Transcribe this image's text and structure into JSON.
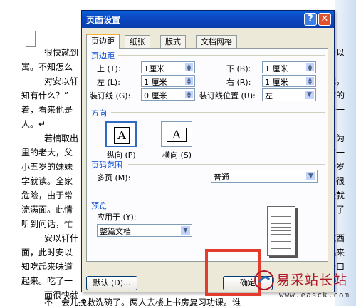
{
  "document": {
    "lines": [
      {
        "left": "很快就到",
        "right": "安以"
      },
      {
        "left": "寓。不知怎么",
        "right": ""
      },
      {
        "left": "对安以轩",
        "right": "吧，"
      },
      {
        "left": "知有什么？”",
        "right": "满的"
      },
      {
        "left": "着，看来他是",
        "right": "是一"
      },
      {
        "left": "人。↵",
        "right": ""
      },
      {
        "left": "若楠取出",
        "right": "因为"
      },
      {
        "left": "里的老大，父",
        "right": "有一"
      },
      {
        "left": "小五岁的妹妹",
        "right": "十岁"
      },
      {
        "left": "学就读。全家",
        "right": "，很"
      },
      {
        "left": "危险，由于常",
        "right": "些就"
      },
      {
        "left": "流满面。此情",
        "right": "哭了"
      },
      {
        "left": "听到问话，忙",
        "right": ""
      },
      {
        "left": "安以轩什",
        "right": "碗西"
      },
      {
        "left": "面，此时安以",
        "right": "起来"
      },
      {
        "left": "知吃起来味道",
        "right": "十口"
      },
      {
        "left": "起来。吃了一",
        "right": ""
      },
      {
        "left": "面很快就",
        "right": ""
      },
      {
        "left": "不一会儿挽救洗碗了。两人去楼上书房复习功课。谁",
        "right": ""
      }
    ]
  },
  "dialog": {
    "title": "页面设置",
    "help_glyph": "?",
    "close_glyph": "✕",
    "tabs": [
      "页边距",
      "纸张",
      "版式",
      "文档网格"
    ],
    "active_tab": 0,
    "margins": {
      "section_label": "页边距",
      "top_label": "上 (T):",
      "top_value": "1厘米",
      "bottom_label": "下 (B):",
      "bottom_value": "1 厘米",
      "left_label": "左 (L):",
      "left_value": "1 厘米",
      "right_label": "右 (R):",
      "right_value": "1 厘米",
      "gutter_label": "装订线 (G):",
      "gutter_value": "0 厘米",
      "gutter_pos_label": "装订线位置 (U):",
      "gutter_pos_value": "左"
    },
    "orientation": {
      "section_label": "方向",
      "portrait_label": "纵向 (P)",
      "landscape_label": "横向 (S)",
      "icon_letter": "A",
      "selected": "portrait"
    },
    "pages": {
      "section_label": "页码范围",
      "multiple_label": "多页 (M):",
      "multiple_value": "普通"
    },
    "preview": {
      "section_label": "预览",
      "apply_label": "应用于 (Y):",
      "apply_value": "整篇文档"
    },
    "buttons": {
      "default_label": "默认 (D)...",
      "ok_label": "确定"
    }
  },
  "watermark": {
    "text": "易采站长站",
    "url": "www.easck.com"
  },
  "colors": {
    "titlebar": "#0a48c2",
    "dialog_bg": "#ece9d8",
    "section_text": "#0046d5",
    "highlight_box": "#e23c2c",
    "watermark_text": "#b0182a"
  }
}
